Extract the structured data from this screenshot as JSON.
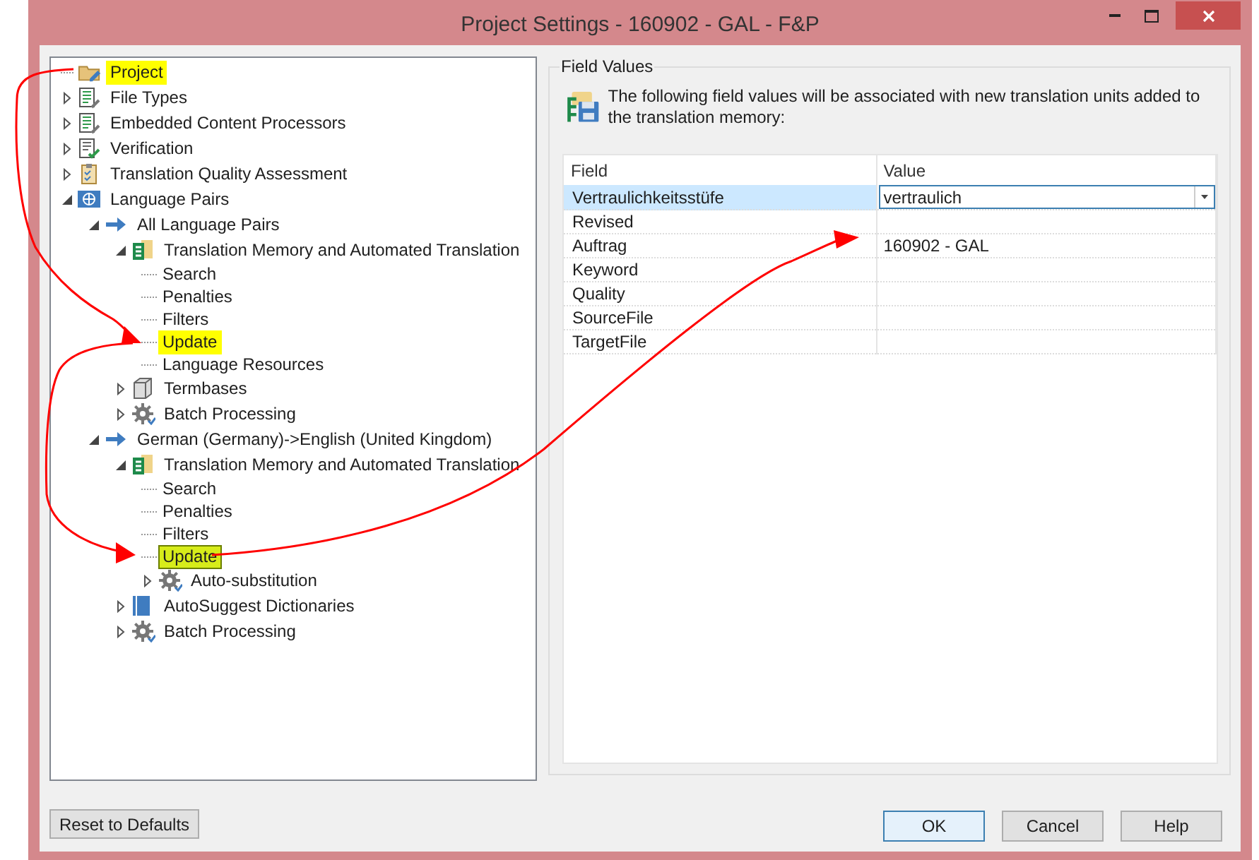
{
  "window": {
    "title": "Project Settings - 160902 - GAL - F&P"
  },
  "tree": [
    {
      "label": "Project",
      "kind": "project",
      "selected": false,
      "highlighted": true
    },
    {
      "label": "File Types",
      "kind": "document",
      "expanded": false,
      "selected": false,
      "highlighted": false
    },
    {
      "label": "Embedded Content Processors",
      "kind": "document",
      "expanded": false,
      "selected": false,
      "highlighted": false
    },
    {
      "label": "Verification",
      "kind": "checklist",
      "expanded": false,
      "selected": false,
      "highlighted": false
    },
    {
      "label": "Translation Quality Assessment",
      "kind": "clipboard",
      "expanded": false,
      "selected": false,
      "highlighted": false
    },
    {
      "label": "Language Pairs",
      "kind": "globe",
      "expanded": true,
      "selected": false,
      "highlighted": false,
      "children": [
        {
          "label": "All Language Pairs",
          "kind": "arrow",
          "expanded": true,
          "selected": false,
          "highlighted": false,
          "children": [
            {
              "label": "Translation Memory and Automated Translation",
              "kind": "memory",
              "expanded": true,
              "selected": false,
              "highlighted": false,
              "children": [
                {
                  "label": "Search",
                  "kind": "leaf",
                  "selected": false,
                  "highlighted": false
                },
                {
                  "label": "Penalties",
                  "kind": "leaf",
                  "selected": false,
                  "highlighted": false
                },
                {
                  "label": "Filters",
                  "kind": "leaf",
                  "selected": false,
                  "highlighted": false
                },
                {
                  "label": "Update",
                  "kind": "leaf",
                  "selected": false,
                  "highlighted": true
                },
                {
                  "label": "Language Resources",
                  "kind": "leaf",
                  "selected": false,
                  "highlighted": false
                }
              ]
            },
            {
              "label": "Termbases",
              "kind": "termbase",
              "expanded": false,
              "selected": false,
              "highlighted": false
            },
            {
              "label": "Batch Processing",
              "kind": "gear",
              "expanded": false,
              "selected": false,
              "highlighted": false
            }
          ]
        },
        {
          "label": "German (Germany)->English (United Kingdom)",
          "kind": "arrow",
          "expanded": true,
          "selected": false,
          "highlighted": false,
          "children": [
            {
              "label": "Translation Memory and Automated Translation",
              "kind": "memory",
              "expanded": true,
              "selected": false,
              "highlighted": false,
              "children": [
                {
                  "label": "Search",
                  "kind": "leaf",
                  "selected": false,
                  "highlighted": false
                },
                {
                  "label": "Penalties",
                  "kind": "leaf",
                  "selected": false,
                  "highlighted": false
                },
                {
                  "label": "Filters",
                  "kind": "leaf",
                  "selected": false,
                  "highlighted": false
                },
                {
                  "label": "Update",
                  "kind": "leaf",
                  "selected": true,
                  "highlighted": true
                },
                {
                  "label": "Auto-substitution",
                  "kind": "gear",
                  "expanded": false,
                  "selected": false,
                  "highlighted": false
                }
              ]
            },
            {
              "label": "AutoSuggest Dictionaries",
              "kind": "book",
              "expanded": false,
              "selected": false,
              "highlighted": false
            },
            {
              "label": "Batch Processing",
              "kind": "gear",
              "expanded": false,
              "selected": false,
              "highlighted": false
            }
          ]
        }
      ]
    }
  ],
  "panel": {
    "title": "Field Values",
    "description": "The following field values will be associated with new translation units added to the translation memory:",
    "columns": [
      "Field",
      "Value"
    ],
    "rows": [
      {
        "field": "Vertraulichkeitsstüfe",
        "value": "vertraulich",
        "selected": true,
        "editing": true
      },
      {
        "field": "Revised",
        "selected": false
      },
      {
        "field": "Auftrag",
        "value": "160902 - GAL",
        "selected": false
      },
      {
        "field": "Keyword",
        "selected": false
      },
      {
        "field": "Quality",
        "selected": false
      },
      {
        "field": "SourceFile",
        "selected": false
      },
      {
        "field": "TargetFile",
        "selected": false
      }
    ]
  },
  "buttons": [
    {
      "label": "Reset to Defaults",
      "kind": "left",
      "default": false
    },
    {
      "label": "OK",
      "kind": "right",
      "default": true
    },
    {
      "label": "Cancel",
      "kind": "right",
      "default": false
    },
    {
      "label": "Help",
      "kind": "right",
      "default": false
    }
  ],
  "annotations": [
    {
      "kind": "arrow"
    },
    {
      "kind": "arrow"
    },
    {
      "kind": "arrow"
    }
  ]
}
